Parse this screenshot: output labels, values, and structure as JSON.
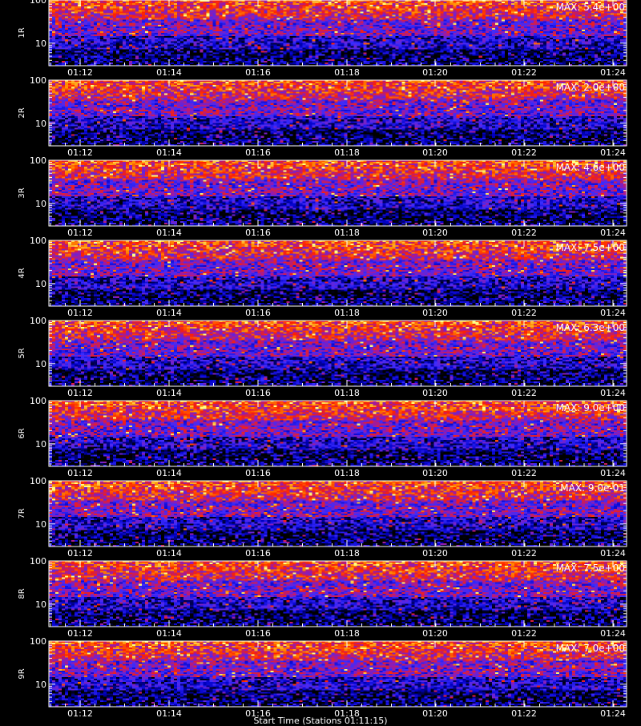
{
  "chart_data": {
    "type": "heatmap",
    "x_ticks": [
      "01:12",
      "01:14",
      "01:16",
      "01:18",
      "01:20",
      "01:22",
      "01:24"
    ],
    "y_scale": "log",
    "y_ticks": [
      "10",
      "100"
    ],
    "y_range": [
      3,
      100
    ],
    "colormap": [
      "#000000",
      "#0000c8",
      "#3a2cff",
      "#9a1aa8",
      "#ff2000",
      "#ff8c00",
      "#ffff80"
    ],
    "panels": [
      {
        "label": "1R",
        "max_label": "MAX: 5.4e+00",
        "max": 5.4
      },
      {
        "label": "2R",
        "max_label": "MAX: 2.0e+00",
        "max": 2.0
      },
      {
        "label": "3R",
        "max_label": "MAX: 4.6e+00",
        "max": 4.6
      },
      {
        "label": "4R",
        "max_label": "MAX: 7.5e+00",
        "max": 7.5
      },
      {
        "label": "5R",
        "max_label": "MAX: 6.3e+00",
        "max": 6.3
      },
      {
        "label": "6R",
        "max_label": "MAX: 9.0e+00",
        "max": 9.0
      },
      {
        "label": "7R",
        "max_label": "MAX: 9.0e-01",
        "max": 0.9
      },
      {
        "label": "8R",
        "max_label": "MAX: 7.5e+00",
        "max": 7.5
      },
      {
        "label": "9R",
        "max_label": "MAX: 7.0e+00",
        "max": 7.0
      }
    ],
    "xlabel": "Start Time (Stations 01:11:15)"
  }
}
